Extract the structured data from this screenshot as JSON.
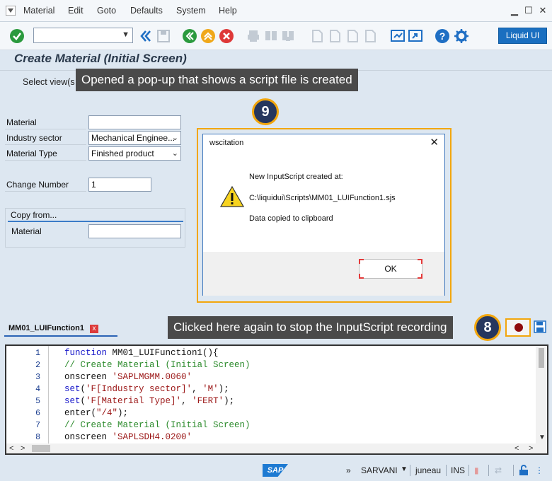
{
  "menubar": {
    "items": [
      "Material",
      "Edit",
      "Goto",
      "Defaults",
      "System",
      "Help"
    ]
  },
  "toolbar": {
    "command_field_value": "",
    "liquid_ui_label": "Liquid UI"
  },
  "screen": {
    "title": "Create Material (Initial Screen)",
    "select_views_label": "Select view(s"
  },
  "callouts": {
    "popup_banner": "Opened a pop-up that shows a script file is created",
    "popup_step": "9",
    "stop_banner": "Clicked here again to stop the InputScript recording",
    "stop_step": "8"
  },
  "form": {
    "material_label": "Material",
    "material_value": "",
    "industry_label": "Industry sector",
    "industry_value": "Mechanical Enginee...",
    "type_label": "Material Type",
    "type_value": "Finished product",
    "change_label": "Change Number",
    "change_value": "1",
    "copy_from_header": "Copy from...",
    "copy_material_label": "Material",
    "copy_material_value": ""
  },
  "dialog": {
    "title": "wscitation",
    "line1": "New InputScript created at:",
    "line2": "C:\\liquidui\\Scripts\\MM01_LUIFunction1.sjs",
    "line3": "Data copied to clipboard",
    "ok_label": "OK"
  },
  "editor": {
    "tab_label": "MM01_LUIFunction1",
    "lines": [
      {
        "num": "1",
        "parts": [
          {
            "k": "kw",
            "t": "function "
          },
          {
            "k": "tx",
            "t": "MM01_LUIFunction1(){"
          }
        ]
      },
      {
        "num": "2",
        "parts": [
          {
            "k": "cm",
            "t": "// Create Material (Initial Screen)"
          }
        ]
      },
      {
        "num": "3",
        "parts": [
          {
            "k": "tx",
            "t": "onscreen "
          },
          {
            "k": "st",
            "t": "'SAPLMGMM.0060'"
          }
        ]
      },
      {
        "num": "4",
        "parts": [
          {
            "k": "kw",
            "t": "set"
          },
          {
            "k": "tx",
            "t": "("
          },
          {
            "k": "st",
            "t": "'F[Industry sector]'"
          },
          {
            "k": "tx",
            "t": ", "
          },
          {
            "k": "st",
            "t": "'M'"
          },
          {
            "k": "tx",
            "t": ");"
          }
        ]
      },
      {
        "num": "5",
        "parts": [
          {
            "k": "kw",
            "t": "set"
          },
          {
            "k": "tx",
            "t": "("
          },
          {
            "k": "st",
            "t": "'F[Material Type]'"
          },
          {
            "k": "tx",
            "t": ", "
          },
          {
            "k": "st",
            "t": "'FERT'"
          },
          {
            "k": "tx",
            "t": ");"
          }
        ]
      },
      {
        "num": "6",
        "parts": [
          {
            "k": "tx",
            "t": "enter("
          },
          {
            "k": "st",
            "t": "\"/4\""
          },
          {
            "k": "tx",
            "t": ");"
          }
        ]
      },
      {
        "num": "7",
        "parts": [
          {
            "k": "cm",
            "t": "// Create Material (Initial Screen)"
          }
        ]
      },
      {
        "num": "8",
        "parts": [
          {
            "k": "tx",
            "t": "onscreen "
          },
          {
            "k": "st",
            "t": "'SAPLSDH4.0200'"
          }
        ]
      }
    ]
  },
  "statusbar": {
    "logo": "SAP",
    "system": "SARVANI",
    "client": "juneau",
    "mode": "INS"
  },
  "colors": {
    "accent": "#f2a60d",
    "badge": "#26375e",
    "brand_blue": "#1a6fc0"
  }
}
